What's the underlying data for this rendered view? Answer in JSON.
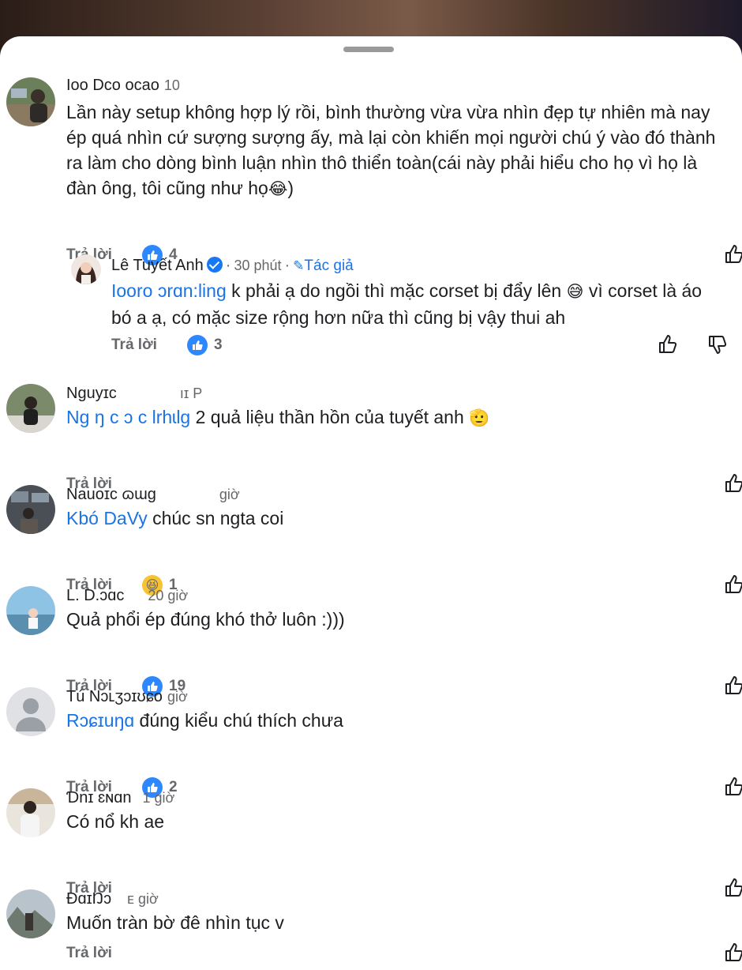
{
  "comments": [
    {
      "name": "Ioo Dco ocao",
      "time": "10",
      "text": "Lần này setup không hợp lý rồi, bình thường vừa vừa nhìn đẹp tự nhiên mà nay ép quá nhìn cứ sượng sượng ấy, mà lại còn khiến mọi người chú ý vào đó thành ra làm cho dòng bình luận nhìn thô thiển toàn(cái này phải hiểu cho họ vì họ là đàn ông, tôi cũng như họ",
      "text_end": ")",
      "emoji": "😂",
      "reply_label": "Trả lời",
      "reaction_count": "4"
    },
    {
      "name": "Lê Tuyết Anh",
      "time": "30 phút",
      "dot": "·",
      "author_label": "Tác giả",
      "mention": "Iooro ɔrɑn:ling",
      "text": " k phải ạ do ngồi thì mặc corset bị đẩy lên ",
      "emoji": "😅",
      "text_end": " vì corset là áo bó a ạ, có mặc size rộng hơn nữa thì cũng bị vậy thui ah",
      "reply_label": "Trả lời",
      "reaction_count": "3"
    },
    {
      "name": "Nguyɪc",
      "time": "ıɪ P",
      "mention": "Ng ŋ c     ɔ c Ɩrhɩlɡ",
      "text": " 2 quả liệu thần hồn của tuyết anh ",
      "emoji": "🫡",
      "reply_label": "Trả lời"
    },
    {
      "name": "Nauoɪc ɷɯɡ",
      "time": "giờ",
      "mention": "Kbó DaVy",
      "text": " chúc sn ngta coi",
      "reply_label": "Trả lời",
      "reaction_emoji": "😆",
      "reaction_count": "1"
    },
    {
      "name": "L. D.ɔɑc",
      "time": "20 giờ",
      "text": "Quả phổi ép đúng khó thở luôn :)))",
      "reply_label": "Trả lời",
      "reaction_count": "19"
    },
    {
      "name": "Tú Nɔʟʒɔɪʊɕo",
      "time": "giờ",
      "mention": "Rɔɕɪuŋɑ",
      "text": " đúng kiểu chú thích chưa",
      "reply_label": "Trả lời",
      "reaction_count": "2"
    },
    {
      "name": "Ɗnɪ ɛɴɑn",
      "time": "1 giờ",
      "text": "Có nổ kh ae",
      "reply_label": "Trả lời"
    },
    {
      "name": "ĐɑɪŊɔ",
      "time": "ᴇ giờ",
      "text": "Muốn tràn bờ đê nhìn tục v",
      "reply_label": "Trả lời"
    }
  ],
  "colors": {
    "like_blue": "#2d88ff",
    "mention_blue": "#1b74e4",
    "meta_gray": "#65676b"
  },
  "icons": [
    "like-reaction-icon",
    "haha-reaction-icon",
    "upvote-icon",
    "downvote-icon",
    "verified-badge-icon",
    "pencil-icon"
  ]
}
